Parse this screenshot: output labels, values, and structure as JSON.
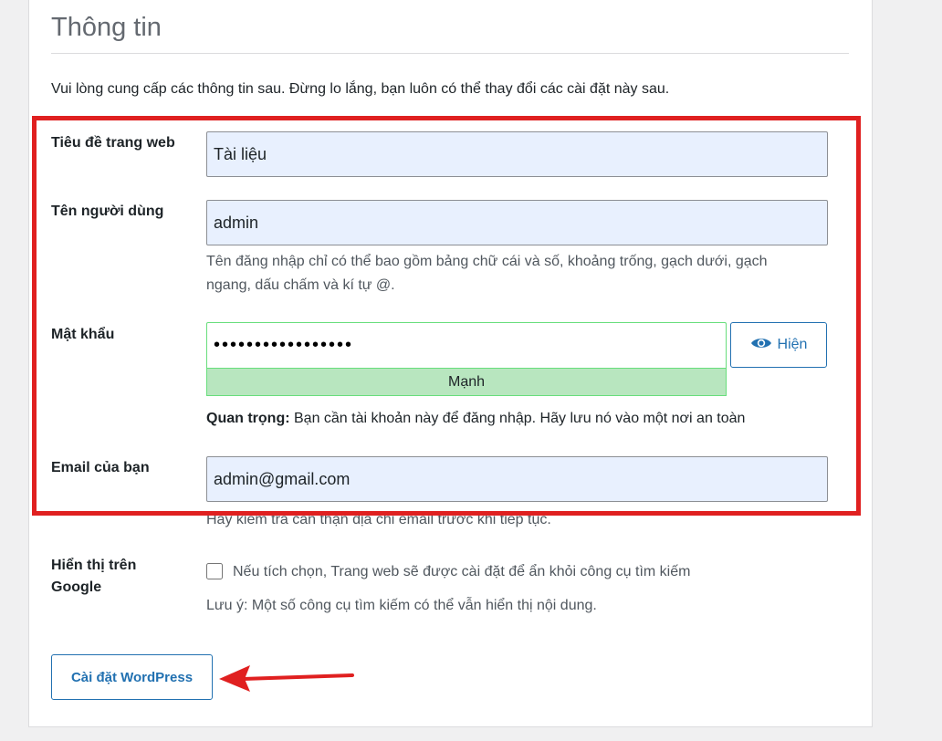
{
  "heading": "Thông tin",
  "intro": "Vui lòng cung cấp các thông tin sau. Đừng lo lắng, bạn luôn có thể thay đổi các cài đặt này sau.",
  "site_title": {
    "label": "Tiêu đề trang web",
    "value": "Tài liệu"
  },
  "username": {
    "label": "Tên người dùng",
    "value": "admin",
    "help_line1": "Tên đăng nhập chỉ có thể bao gồm bảng chữ cái và số, khoảng trống, gạch dưới, gạch",
    "help_line2": "ngang, dấu chấm và kí tự @."
  },
  "password": {
    "label": "Mật khẩu",
    "value": "•••••••••••••••••",
    "strength": "Mạnh",
    "show_label": "Hiện",
    "note_bold": "Quan trọng:",
    "note_rest": " Bạn cần tài khoản này để đăng nhập. Hãy lưu nó vào một nơi an toàn"
  },
  "email": {
    "label": "Email của bạn",
    "value": "admin@gmail.com",
    "help": "Hãy kiểm tra cẩn thận địa chỉ email trước khi tiếp tục."
  },
  "visibility": {
    "label": "Hiển thị trên Google",
    "checkbox_label": "Nếu tích chọn, Trang web sẽ được cài đặt để ẩn khỏi công cụ tìm kiếm",
    "note": "Lưu ý: Một số công cụ tìm kiếm có thể vẫn hiển thị nội dung."
  },
  "submit_label": "Cài đặt WordPress",
  "colors": {
    "accent": "#2271b1",
    "annotation": "#e02020",
    "strength_bg": "#b8e6bf"
  }
}
